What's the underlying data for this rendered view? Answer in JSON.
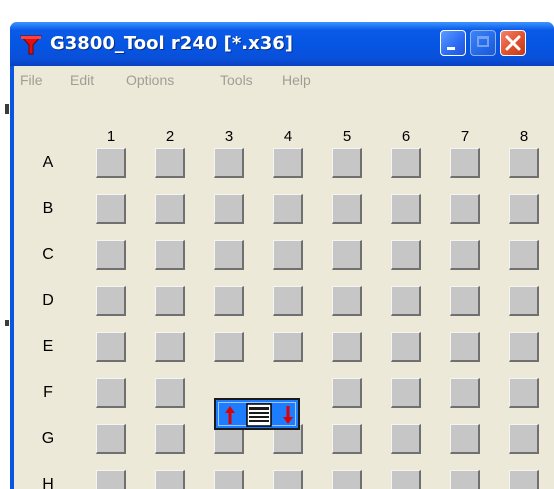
{
  "window": {
    "title": "G3800_Tool r240 [*.x36]",
    "buttons": {
      "minimize": "minimize-icon",
      "maximize": "maximize-icon",
      "close": "close-icon"
    }
  },
  "menu": [
    "File",
    "Edit",
    "Options",
    "Tools",
    "Help"
  ],
  "grid": {
    "columns": [
      "1",
      "2",
      "3",
      "4",
      "5",
      "6",
      "7",
      "8"
    ],
    "rows": [
      "A",
      "B",
      "C",
      "D",
      "E",
      "F",
      "G",
      "H"
    ]
  },
  "popup": {
    "row": "F",
    "columns": [
      "3",
      "4"
    ],
    "icons": [
      "arrow-up-icon",
      "list-icon",
      "arrow-down-icon"
    ]
  },
  "colors": {
    "titlebar": "#0555e3",
    "client": "#ece9d8",
    "menu_text_disabled": "#a09e94",
    "cell": "#c6c6c6",
    "popup": "#1e7dff",
    "arrow": "#e00000"
  }
}
